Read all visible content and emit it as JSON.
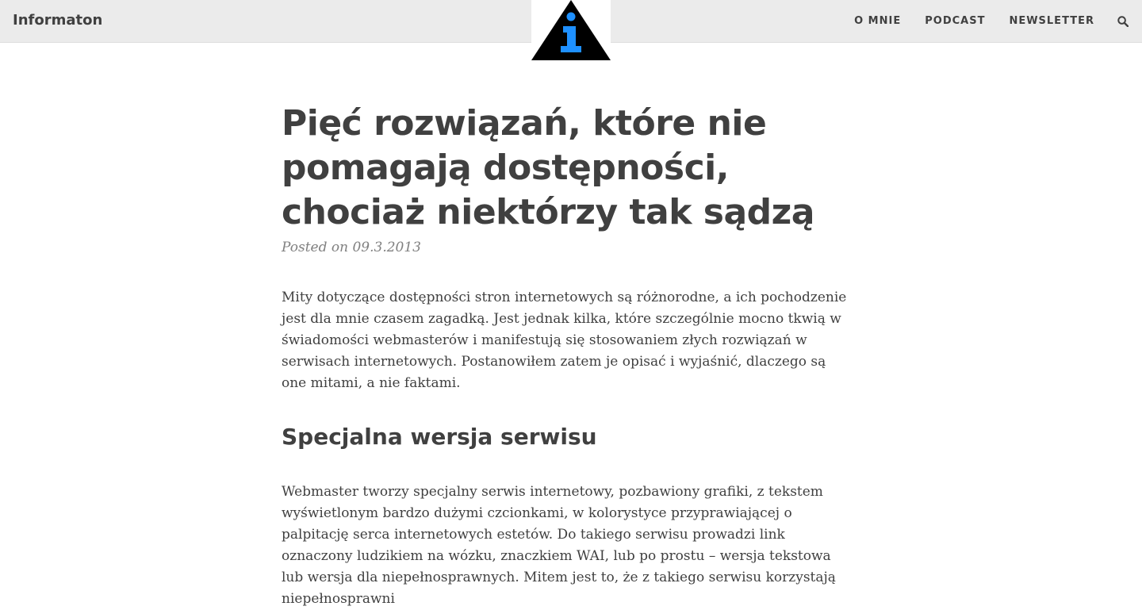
{
  "header": {
    "brand": "Informaton",
    "nav": [
      "O MNIE",
      "PODCAST",
      "NEWSLETTER"
    ],
    "search_icon": "search-icon",
    "logo": {
      "icon": "info-triangle-logo",
      "colors": {
        "triangle": "#000000",
        "glyph": "#1e90ff"
      }
    }
  },
  "article": {
    "title": "Pięć rozwiązań, które nie pomagają dostępności, chociaż niektórzy tak sądzą",
    "meta": "Posted on 09.3.2013",
    "intro": "Mity dotyczące dostępności stron internetowych są różnorodne, a ich pochodzenie jest dla mnie czasem zagadką. Jest jednak kilka, które szczególnie mocno tkwią w świadomości webmasterów i manifestują się stosowaniem złych rozwiązań w serwisach internetowych. Postanowiłem zatem je opisać i wyjaśnić, dlaczego są one mitami, a nie faktami.",
    "section_heading": "Specjalna wersja serwisu",
    "section_paragraph": "Webmaster tworzy specjalny serwis internetowy, pozbawiony grafiki, z tekstem wyświetlonym bardzo dużymi czcionkami, w kolorystyce przyprawiającej o palpitację serca internetowych estetów. Do takiego serwisu prowadzi link oznaczony ludzikiem na wózku, znaczkiem WAI, lub po prostu – wersja tekstowa lub wersja dla niepełnosprawnych. Mitem jest to, że z takiego serwisu korzystają niepełnosprawni"
  }
}
